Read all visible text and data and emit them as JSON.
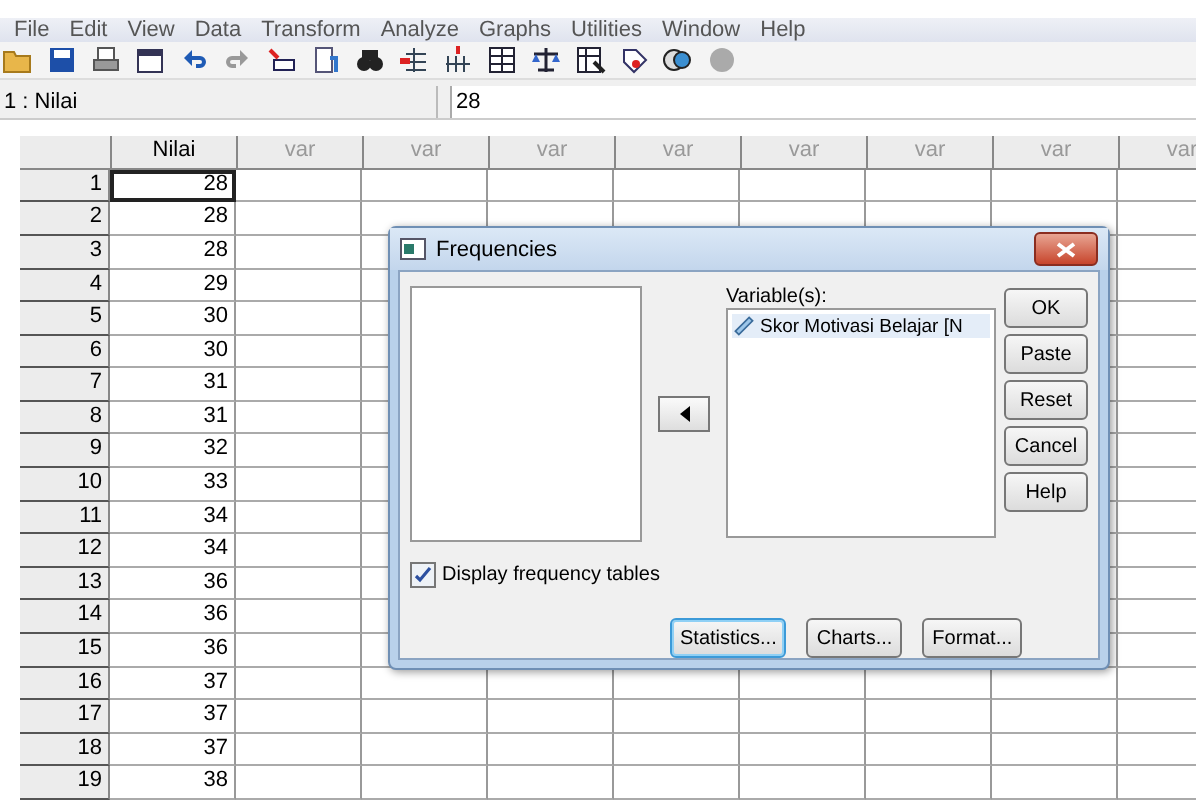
{
  "menu": [
    "File",
    "Edit",
    "View",
    "Data",
    "Transform",
    "Analyze",
    "Graphs",
    "Utilities",
    "Window",
    "Help"
  ],
  "toolbar": [
    {
      "kind": "folder"
    },
    {
      "kind": "save"
    },
    {
      "kind": "print"
    },
    {
      "kind": "dialog"
    },
    {
      "kind": "undo"
    },
    {
      "kind": "redo"
    },
    {
      "kind": "goto"
    },
    {
      "kind": "variables"
    },
    {
      "kind": "find"
    },
    {
      "kind": "insert-case"
    },
    {
      "kind": "insert-variable"
    },
    {
      "kind": "grid"
    },
    {
      "kind": "scale"
    },
    {
      "kind": "select"
    },
    {
      "kind": "labels"
    },
    {
      "kind": "sets"
    },
    {
      "kind": "circle"
    }
  ],
  "cell_editor": {
    "reference": "1 : Nilai",
    "value": "28"
  },
  "columns": [
    {
      "label": "Nilai",
      "defined": true
    },
    {
      "label": "var",
      "defined": false
    },
    {
      "label": "var",
      "defined": false
    },
    {
      "label": "var",
      "defined": false
    },
    {
      "label": "var",
      "defined": false
    },
    {
      "label": "var",
      "defined": false
    },
    {
      "label": "var",
      "defined": false
    },
    {
      "label": "var",
      "defined": false
    },
    {
      "label": "var",
      "defined": false
    }
  ],
  "rows": [
    {
      "number": "1",
      "value": "28",
      "selected": true
    },
    {
      "number": "2",
      "value": "28",
      "selected": false
    },
    {
      "number": "3",
      "value": "28",
      "selected": false
    },
    {
      "number": "4",
      "value": "29",
      "selected": false
    },
    {
      "number": "5",
      "value": "30",
      "selected": false
    },
    {
      "number": "6",
      "value": "30",
      "selected": false
    },
    {
      "number": "7",
      "value": "31",
      "selected": false
    },
    {
      "number": "8",
      "value": "31",
      "selected": false
    },
    {
      "number": "9",
      "value": "32",
      "selected": false
    },
    {
      "number": "10",
      "value": "33",
      "selected": false
    },
    {
      "number": "11",
      "value": "34",
      "selected": false
    },
    {
      "number": "12",
      "value": "34",
      "selected": false
    },
    {
      "number": "13",
      "value": "36",
      "selected": false
    },
    {
      "number": "14",
      "value": "36",
      "selected": false
    },
    {
      "number": "15",
      "value": "36",
      "selected": false
    },
    {
      "number": "16",
      "value": "37",
      "selected": false
    },
    {
      "number": "17",
      "value": "37",
      "selected": false
    },
    {
      "number": "18",
      "value": "37",
      "selected": false
    },
    {
      "number": "19",
      "value": "38",
      "selected": false
    }
  ],
  "dialog": {
    "title": "Frequencies",
    "variables_label": "Variable(s):",
    "variables": [
      {
        "name": "Skor Motivasi Belajar [N",
        "selected": true
      }
    ],
    "checkbox": {
      "label": "Display frequency tables",
      "checked": true
    },
    "side_buttons": [
      "OK",
      "Paste",
      "Reset",
      "Cancel",
      "Help"
    ],
    "bottom_buttons": [
      {
        "label": "Statistics...",
        "focused": true
      },
      {
        "label": "Charts...",
        "focused": false
      },
      {
        "label": "Format...",
        "focused": false
      }
    ]
  }
}
